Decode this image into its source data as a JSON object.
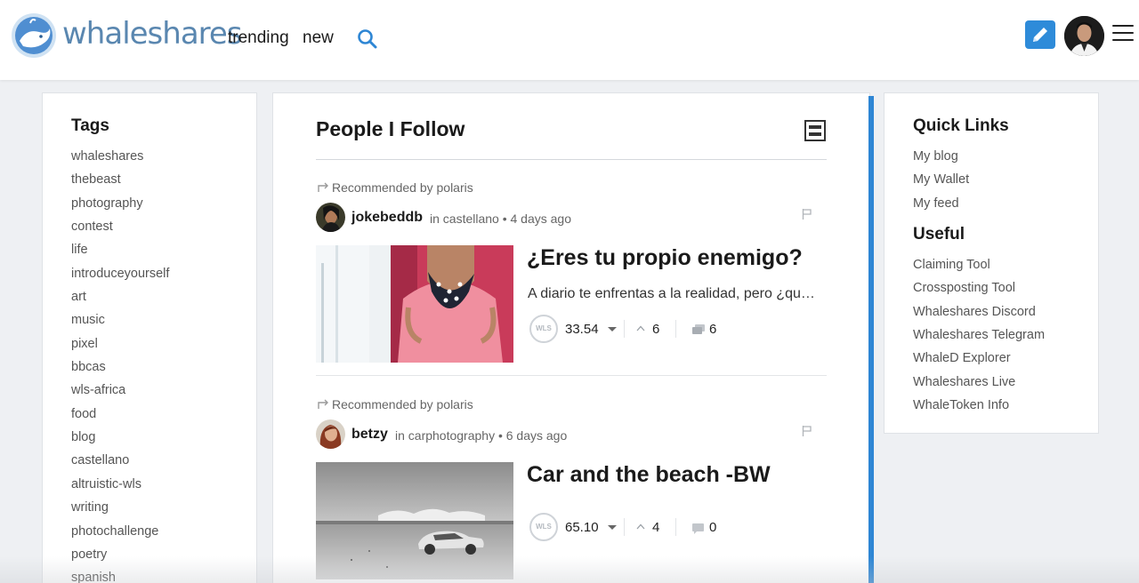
{
  "header": {
    "brand": "whaleshares",
    "nav": [
      {
        "label": "trending"
      },
      {
        "label": "new"
      }
    ],
    "icons": {
      "search": "search-icon",
      "write": "pencil-icon",
      "menu": "hamburger-menu-icon"
    },
    "accent_color": "#2e8bd9"
  },
  "tags": {
    "title": "Tags",
    "items": [
      "whaleshares",
      "thebeast",
      "photography",
      "contest",
      "life",
      "introduceyourself",
      "art",
      "music",
      "pixel",
      "bbcas",
      "wls-africa",
      "food",
      "blog",
      "castellano",
      "altruistic-wls",
      "writing",
      "photochallenge",
      "poetry",
      "spanish"
    ]
  },
  "feed": {
    "title": "People I Follow",
    "posts": [
      {
        "recommended": "Recommended by polaris",
        "author": "jokebeddb",
        "community": "in castellano",
        "time": "• 4 days ago",
        "title": "¿Eres tu propio enemigo?",
        "excerpt": "A diario te enfrentas a la realidad, pero ¿que haces cuando",
        "payout": "33.54",
        "votes": "6",
        "comments": "6",
        "badge": "WLS"
      },
      {
        "recommended": "Recommended by polaris",
        "author": "betzy",
        "community": "in carphotography",
        "time": "• 6 days ago",
        "title": "Car and the beach -BW",
        "excerpt": "",
        "payout": "65.10",
        "votes": "4",
        "comments": "0",
        "badge": "WLS"
      }
    ]
  },
  "quick_links": {
    "title": "Quick Links",
    "items": [
      "My blog",
      "My Wallet",
      "My feed"
    ]
  },
  "useful": {
    "title": "Useful",
    "items": [
      "Claiming Tool",
      "Crossposting Tool",
      "Whaleshares Discord",
      "Whaleshares Telegram",
      "WhaleD Explorer",
      "Whaleshares Live",
      "WhaleToken Info"
    ]
  }
}
